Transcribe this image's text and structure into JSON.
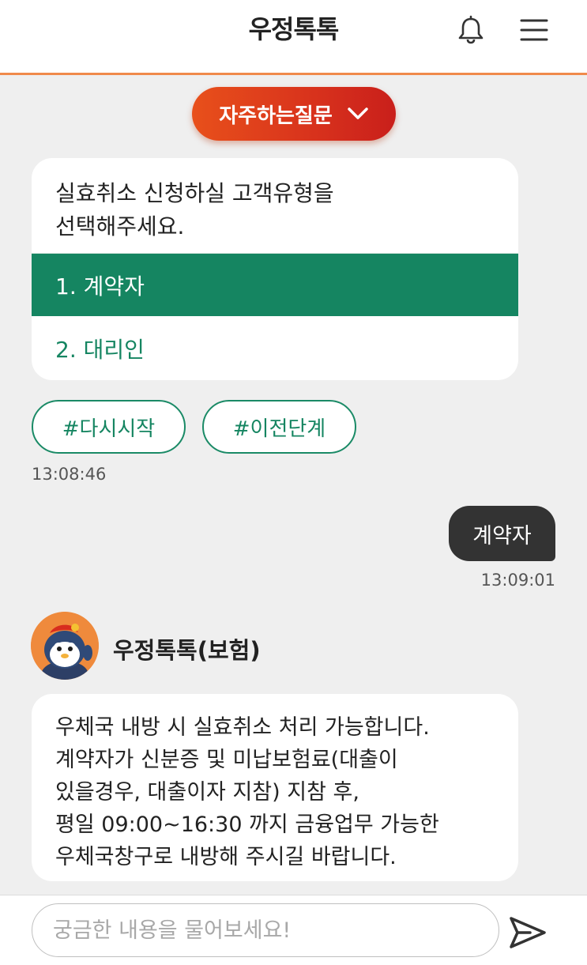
{
  "header": {
    "title": "우정톡톡",
    "icons": [
      "bell-icon",
      "menu-icon"
    ],
    "accent_color": "#f08a4b"
  },
  "faq": {
    "label": "자주하는질문",
    "icon": "chevron-down-icon"
  },
  "card": {
    "prompt_line1": "실효취소 신청하실 고객유형을",
    "prompt_line2": "선택해주세요.",
    "options": [
      {
        "label": "1. 계약자",
        "selected": true
      },
      {
        "label": "2. 대리인",
        "selected": false
      }
    ],
    "selected_color": "#158561"
  },
  "quick_replies": [
    {
      "label": "#다시시작"
    },
    {
      "label": "#이전단계"
    }
  ],
  "messages": {
    "bot_timestamp": "13:08:46",
    "user_text": "계약자",
    "user_timestamp": "13:09:01"
  },
  "bot": {
    "name": "우정톡톡(보험)",
    "avatar": "penguin-avatar",
    "lines": [
      "우체국 내방 시 실효취소 처리 가능합니다.",
      "계약자가 신분증 및 미납보험료(대출이",
      "있을경우, 대출이자 지참) 지참 후,",
      "평일 09:00~16:30 까지 금융업무 가능한",
      "우체국창구로 내방해 주시길 바랍니다."
    ]
  },
  "input": {
    "placeholder": "궁금한 내용을 물어보세요!",
    "value": "",
    "send_icon": "send-icon"
  }
}
